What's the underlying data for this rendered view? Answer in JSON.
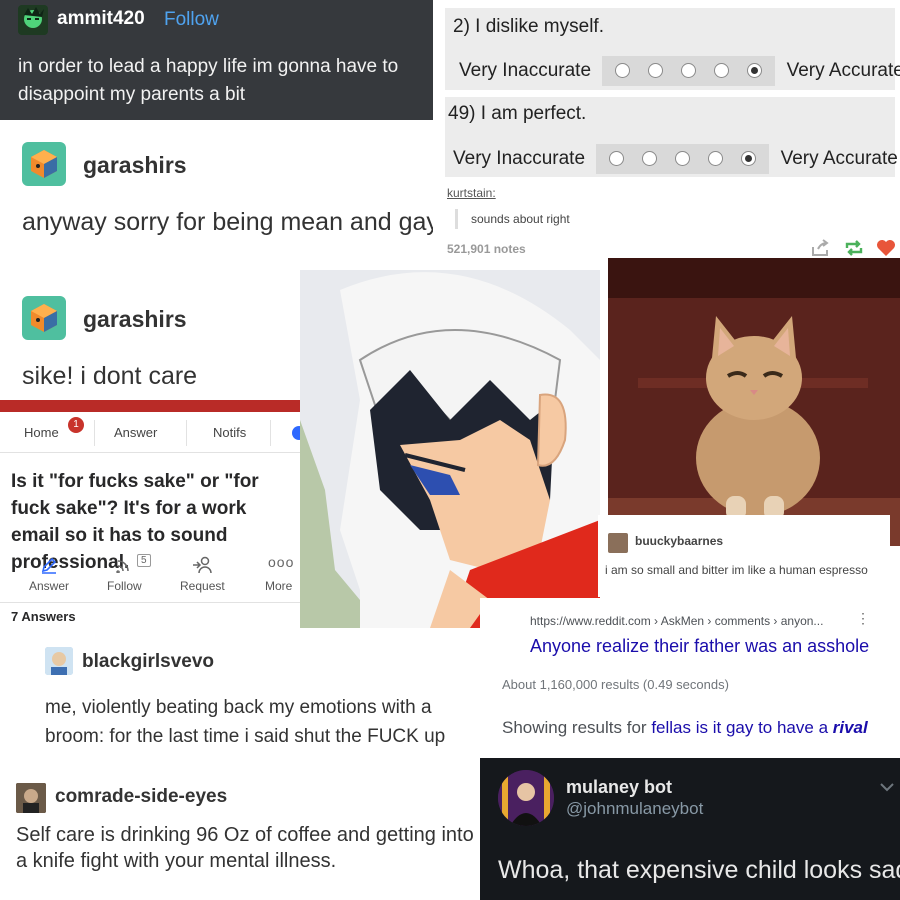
{
  "p1": {
    "username": "ammit420",
    "follow": "Follow",
    "text": "in order to lead a happy life im gonna have to disappoint my parents a bit"
  },
  "p2": {
    "q1": "2) I dislike myself.",
    "q2": "49) I am perfect.",
    "low": "Very Inaccurate",
    "high": "Very Accurate",
    "reblogger": "kurtstain:",
    "reply": "sounds about right",
    "notes": "521,901 notes",
    "heart_color": "#e8553a"
  },
  "p3": {
    "username": "garashirs",
    "text": "anyway sorry for being mean and gay"
  },
  "p4": {
    "username": "garashirs",
    "text": "sike! i dont care"
  },
  "p5": {
    "tabs": [
      "Home",
      "Answer",
      "Notifs"
    ],
    "badge": "1",
    "question": "Is it \"for fucks sake\" or \"for fuck sake\"? It's for a work email so it has to sound professional.",
    "actions": {
      "answer": "Answer",
      "follow": "Follow",
      "follow_count": "5",
      "request": "Request",
      "more": "More"
    },
    "answers": "7 Answers"
  },
  "p8": {
    "username": "buuckybaarnes",
    "text": "i am so small and bitter im like a human espresso"
  },
  "p9": {
    "url": "https://www.reddit.com › AskMen › comments › anyon...",
    "title": "Anyone realize their father was an asshole",
    "stats": "About 1,160,000 results (0.49 seconds)",
    "showing": "Showing results for",
    "query": "fellas is it gay to have a",
    "query_em": "rival"
  },
  "p10": {
    "username": "blackgirlsvevo",
    "text": "me, violently beating back my emotions with a broom: for the last time i said shut the FUCK up"
  },
  "p11": {
    "username": "comrade-side-eyes",
    "text": "Self care is drinking 96 Oz of coffee and getting into a knife fight with your mental illness."
  },
  "p12": {
    "name": "mulaney bot",
    "handle": "@johnmulaneybot",
    "text": "Whoa, that expensive child looks sad!"
  }
}
